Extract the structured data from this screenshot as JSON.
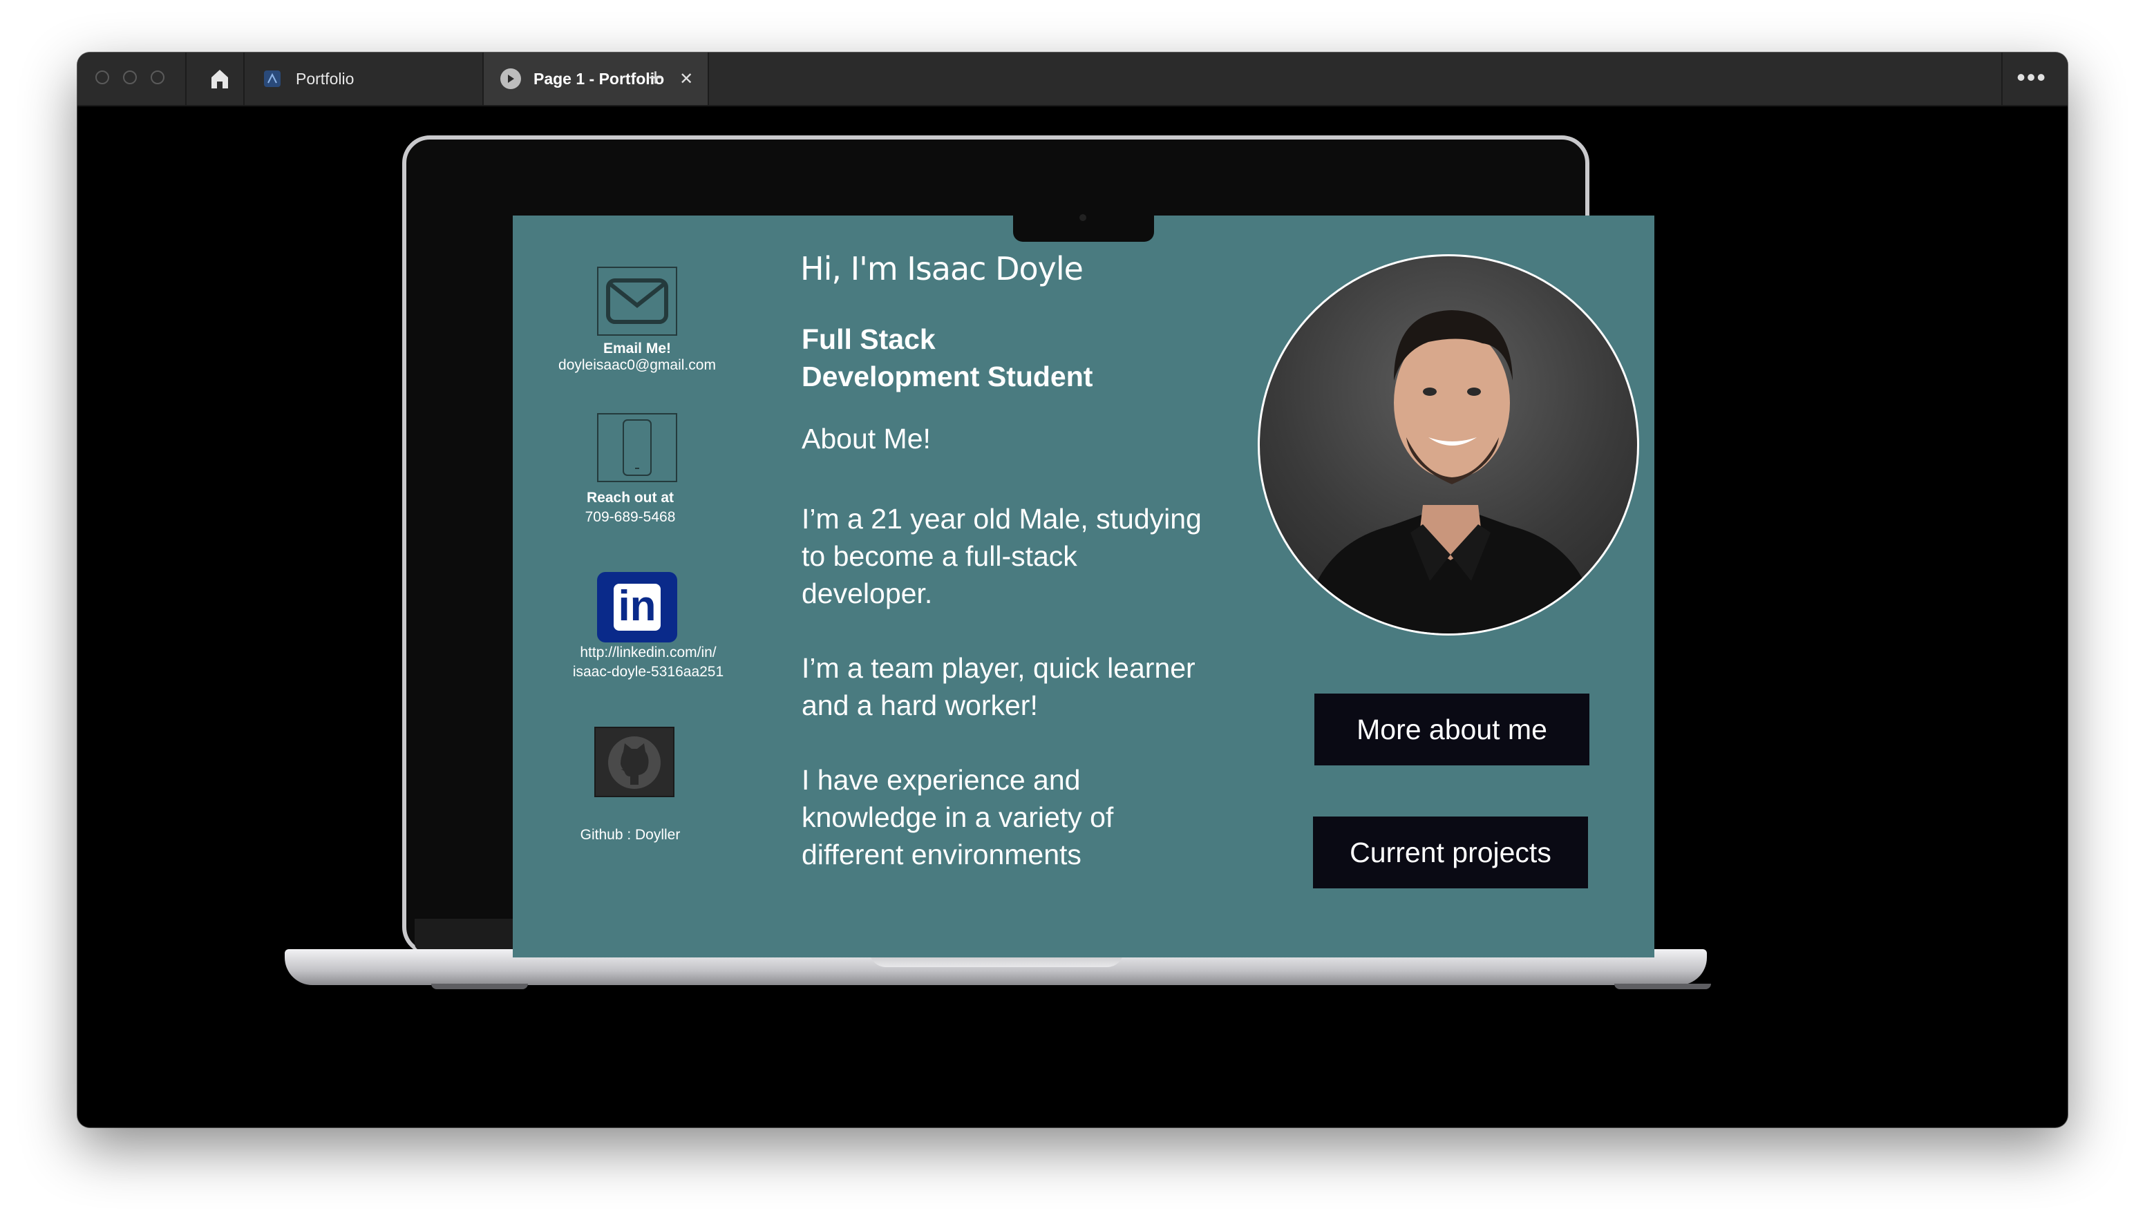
{
  "titlebar": {
    "tabs": [
      {
        "label": "Portfolio",
        "icon": "figma-file-icon",
        "active": false
      },
      {
        "label": "Page 1 - Portfolio",
        "icon": "play-icon",
        "active": true
      }
    ],
    "new_tab_symbol": "+",
    "menu_symbol": "•••",
    "close_symbol": "✕"
  },
  "portfolio": {
    "greeting": "Hi, I'm Isaac Doyle",
    "role_line1": "Full Stack",
    "role_line2": "Development Student",
    "about_heading": "About Me!",
    "about_p1": [
      "I’m a 21 year old Male, studying",
      "to become a full-stack",
      "developer."
    ],
    "about_p2": [
      "I’m a team player, quick learner",
      "and a hard worker!"
    ],
    "about_p3": [
      "I have experience and",
      "knowledge in a variety of",
      "different environments"
    ],
    "contacts": {
      "email_label": "Email Me!",
      "email_value": "doyleisaac0@gmail.com",
      "phone_label": "Reach out at",
      "phone_value": "709-689-5468",
      "linkedin_line1": "http://linkedin.com/in/",
      "linkedin_line2": "isaac-doyle-5316aa251",
      "github_value": "Github : Doyller"
    },
    "linkedin_logo_text": "in",
    "buttons": {
      "more_about": "More about me",
      "current_projects": "Current projects"
    }
  },
  "colors": {
    "screen_background": "#4a7b80",
    "button_background": "#0a0a14",
    "linkedin_blue": "#0a2a8a"
  }
}
